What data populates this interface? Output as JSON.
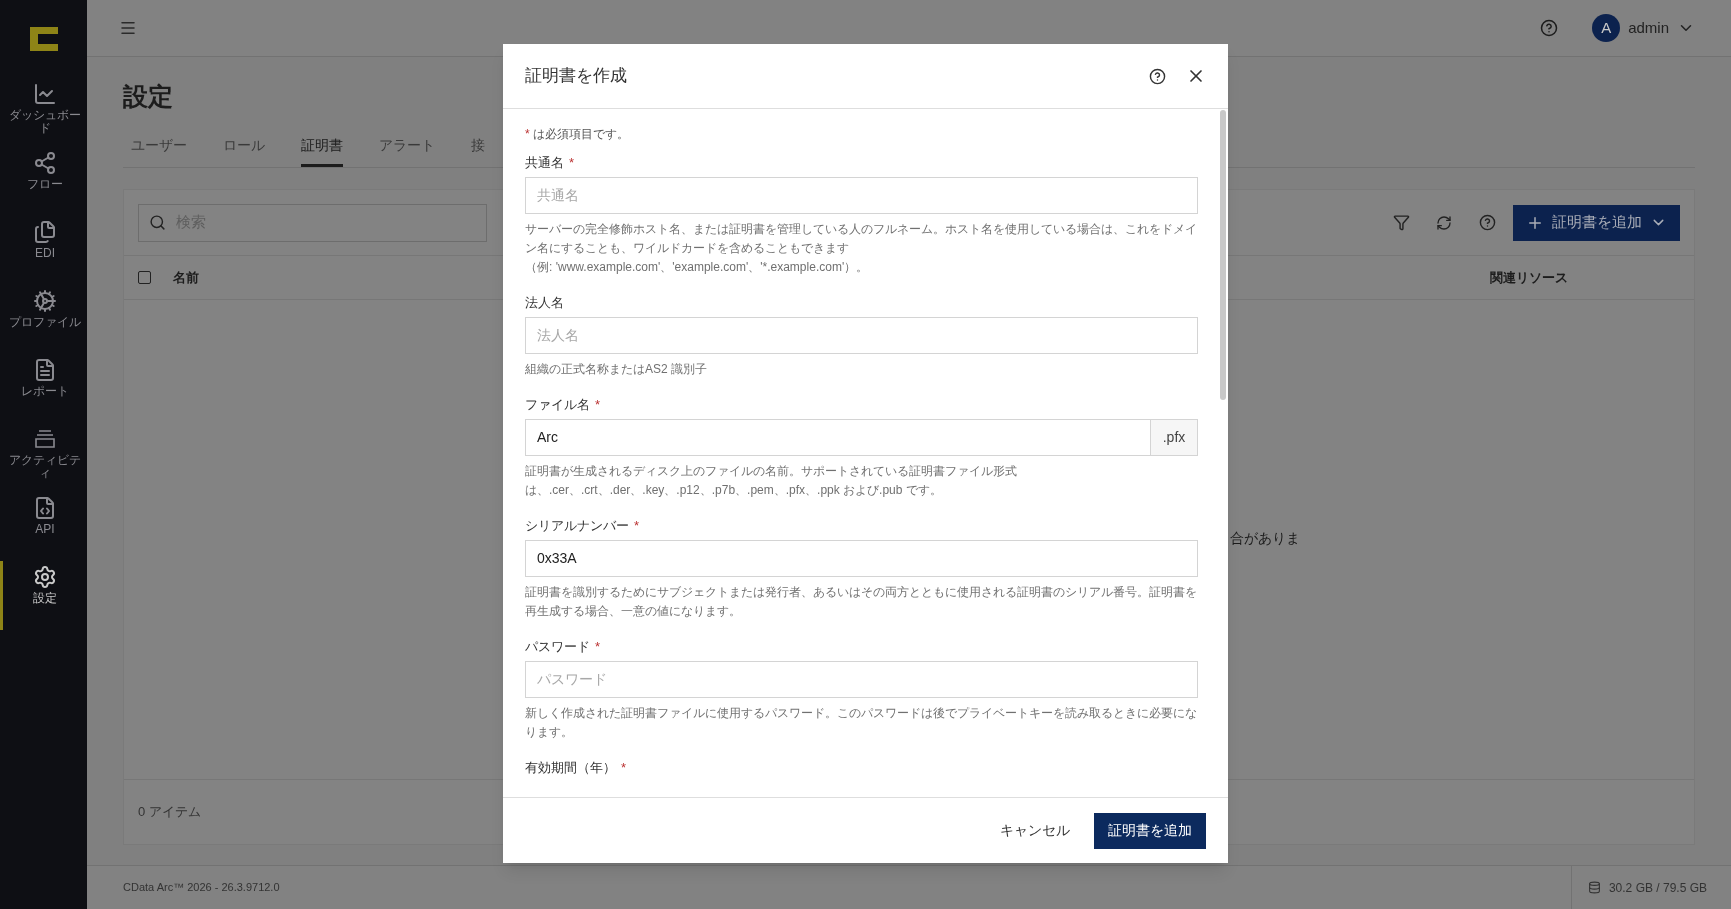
{
  "sidebar": {
    "items": [
      {
        "label": "ダッシュボード",
        "selected": false
      },
      {
        "label": "フロー",
        "selected": false
      },
      {
        "label": "EDI",
        "selected": false
      },
      {
        "label": "プロファイル",
        "selected": false
      },
      {
        "label": "レポート",
        "selected": false
      },
      {
        "label": "アクティビティ",
        "selected": false
      },
      {
        "label": "API",
        "selected": false
      },
      {
        "label": "設定",
        "selected": true
      }
    ]
  },
  "header": {
    "user_initial": "A",
    "user_name": "admin"
  },
  "page": {
    "title": "設定",
    "tabs": [
      {
        "label": "ユーザー",
        "selected": false
      },
      {
        "label": "ロール",
        "selected": false
      },
      {
        "label": "証明書",
        "selected": true
      },
      {
        "label": "アラート",
        "selected": false
      },
      {
        "label": "接",
        "selected": false
      }
    ],
    "search": {
      "placeholder": "検索"
    },
    "add_button": "証明書を追加",
    "table": {
      "columns": [
        "名前",
        "関連リソース"
      ],
      "all_checked": false
    },
    "empty_message": "合がありま",
    "item_count": "0 アイテム"
  },
  "status_bar": {
    "version": "CData Arc™ 2026 - 26.3.9712.0",
    "storage": "30.2 GB / 79.5 GB"
  },
  "dialog": {
    "title": "証明書を作成",
    "required_note": {
      "mark": "*",
      "text": "は必須項目です。"
    },
    "fields": [
      {
        "label": "共通名",
        "required_mark": "*",
        "placeholder": "共通名",
        "help": [
          "サーバーの完全修飾ホスト名、または証明書を管理している人のフルネーム。ホスト名を使用している場合は、これをドメイン名にすることも、ワイルドカードを含めることもできます",
          "（例: 'www.example.com'、'example.com'、'*.example.com'）。"
        ]
      },
      {
        "label": "法人名",
        "placeholder": "法人名",
        "help": [
          "組織の正式名称またはAS2 識別子"
        ]
      },
      {
        "label": "ファイル名",
        "required_mark": "*",
        "value": "Arc",
        "suffix": ".pfx",
        "help": [
          "証明書が生成されるディスク上のファイルの名前。サポートされている証明書ファイル形式",
          "は、.cer、.crt、.der、.key、.p12、.p7b、.pem、.pfx、.ppk および.pub です。"
        ]
      },
      {
        "label": "シリアルナンバー",
        "required_mark": "*",
        "value": "0x33A",
        "help": [
          "証明書を識別するためにサブジェクトまたは発行者、あるいはその両方とともに使用される証明書のシリアル番号。証明書を再生成する場合、一意の値になります。"
        ]
      },
      {
        "label": "パスワード",
        "required_mark": "*",
        "placeholder": "パスワード",
        "help": [
          "新しく作成された証明書ファイルに使用するパスワード。このパスワードは後でプライベートキーを読み取るときに必要になります。"
        ]
      },
      {
        "label": "有効期間（年）",
        "required_mark": "*"
      }
    ],
    "cancel_button": "キャンセル",
    "submit_button": "証明書を追加"
  }
}
